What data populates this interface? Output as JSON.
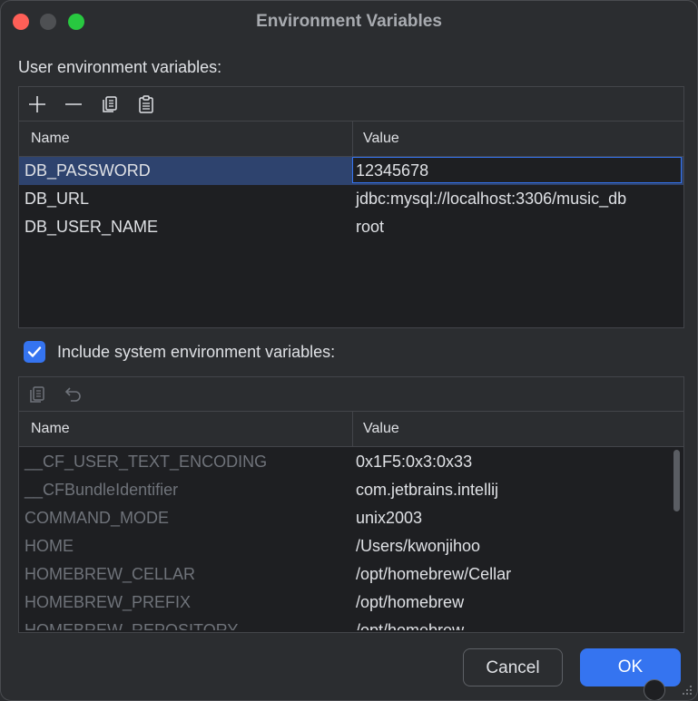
{
  "window": {
    "title": "Environment Variables"
  },
  "user_section": {
    "label": "User environment variables:",
    "toolbar": {
      "icons": [
        "add-icon",
        "remove-icon",
        "copy-icon",
        "paste-icon"
      ]
    },
    "columns": {
      "name": "Name",
      "value": "Value"
    },
    "rows": [
      {
        "name": "DB_PASSWORD",
        "value": "12345678",
        "selected": true
      },
      {
        "name": "DB_URL",
        "value": "jdbc:mysql://localhost:3306/music_db"
      },
      {
        "name": "DB_USER_NAME",
        "value": "root"
      }
    ]
  },
  "system_section": {
    "include_label": "Include system environment variables:",
    "include_checked": true,
    "toolbar": {
      "icons": [
        "copy-icon",
        "undo-icon"
      ]
    },
    "columns": {
      "name": "Name",
      "value": "Value"
    },
    "rows": [
      {
        "name": "__CF_USER_TEXT_ENCODING",
        "value": "0x1F5:0x3:0x33"
      },
      {
        "name": "__CFBundleIdentifier",
        "value": "com.jetbrains.intellij"
      },
      {
        "name": "COMMAND_MODE",
        "value": "unix2003"
      },
      {
        "name": "HOME",
        "value": "/Users/kwonjihoo"
      },
      {
        "name": "HOMEBREW_CELLAR",
        "value": "/opt/homebrew/Cellar"
      },
      {
        "name": "HOMEBREW_PREFIX",
        "value": "/opt/homebrew"
      },
      {
        "name": "HOMEBREW_REPOSITORY",
        "value": "/opt/homebrew"
      }
    ]
  },
  "buttons": {
    "cancel": "Cancel",
    "ok": "OK"
  },
  "colors": {
    "accent": "#3574f0",
    "selection": "#2e436e",
    "background": "#2b2d30"
  }
}
